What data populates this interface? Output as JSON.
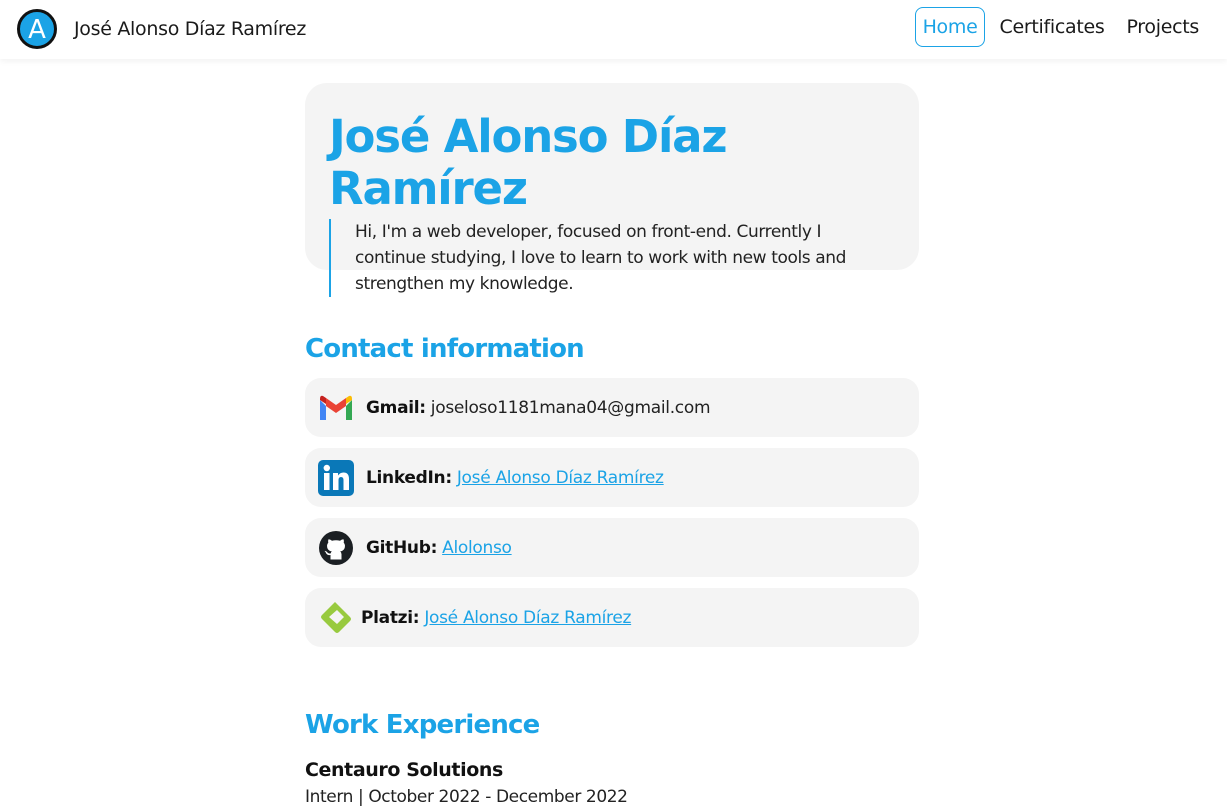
{
  "navbar": {
    "brand_letter": "A",
    "brand_name": "José Alonso Díaz Ramírez",
    "links": [
      "Home",
      "Certificates",
      "Projects"
    ],
    "active": "Home"
  },
  "hero": {
    "name": "José Alonso Díaz Ramírez",
    "bio": "Hi, I'm a web developer, focused on front-end. Currently I continue studying, I love to learn to work with new tools and strengthen my knowledge."
  },
  "contact": {
    "title": "Contact information",
    "items": [
      {
        "icon": "gmail-icon",
        "label": "Gmail:",
        "value": "joseloso1181mana04@gmail.com",
        "link": false
      },
      {
        "icon": "linkedin-icon",
        "label": "LinkedIn:",
        "value": "José Alonso Díaz Ramírez",
        "link": true
      },
      {
        "icon": "github-icon",
        "label": "GitHub:",
        "value": "Alolonso",
        "link": true
      },
      {
        "icon": "platzi-icon",
        "label": "Platzi:",
        "value": "José Alonso Díaz Ramírez",
        "link": true
      }
    ]
  },
  "work": {
    "title": "Work Experience",
    "company": "Centauro Solutions",
    "role": "Intern | October 2022 - December 2022"
  },
  "colors": {
    "accent": "#1ba3e6",
    "card_bg": "#f4f4f4"
  }
}
